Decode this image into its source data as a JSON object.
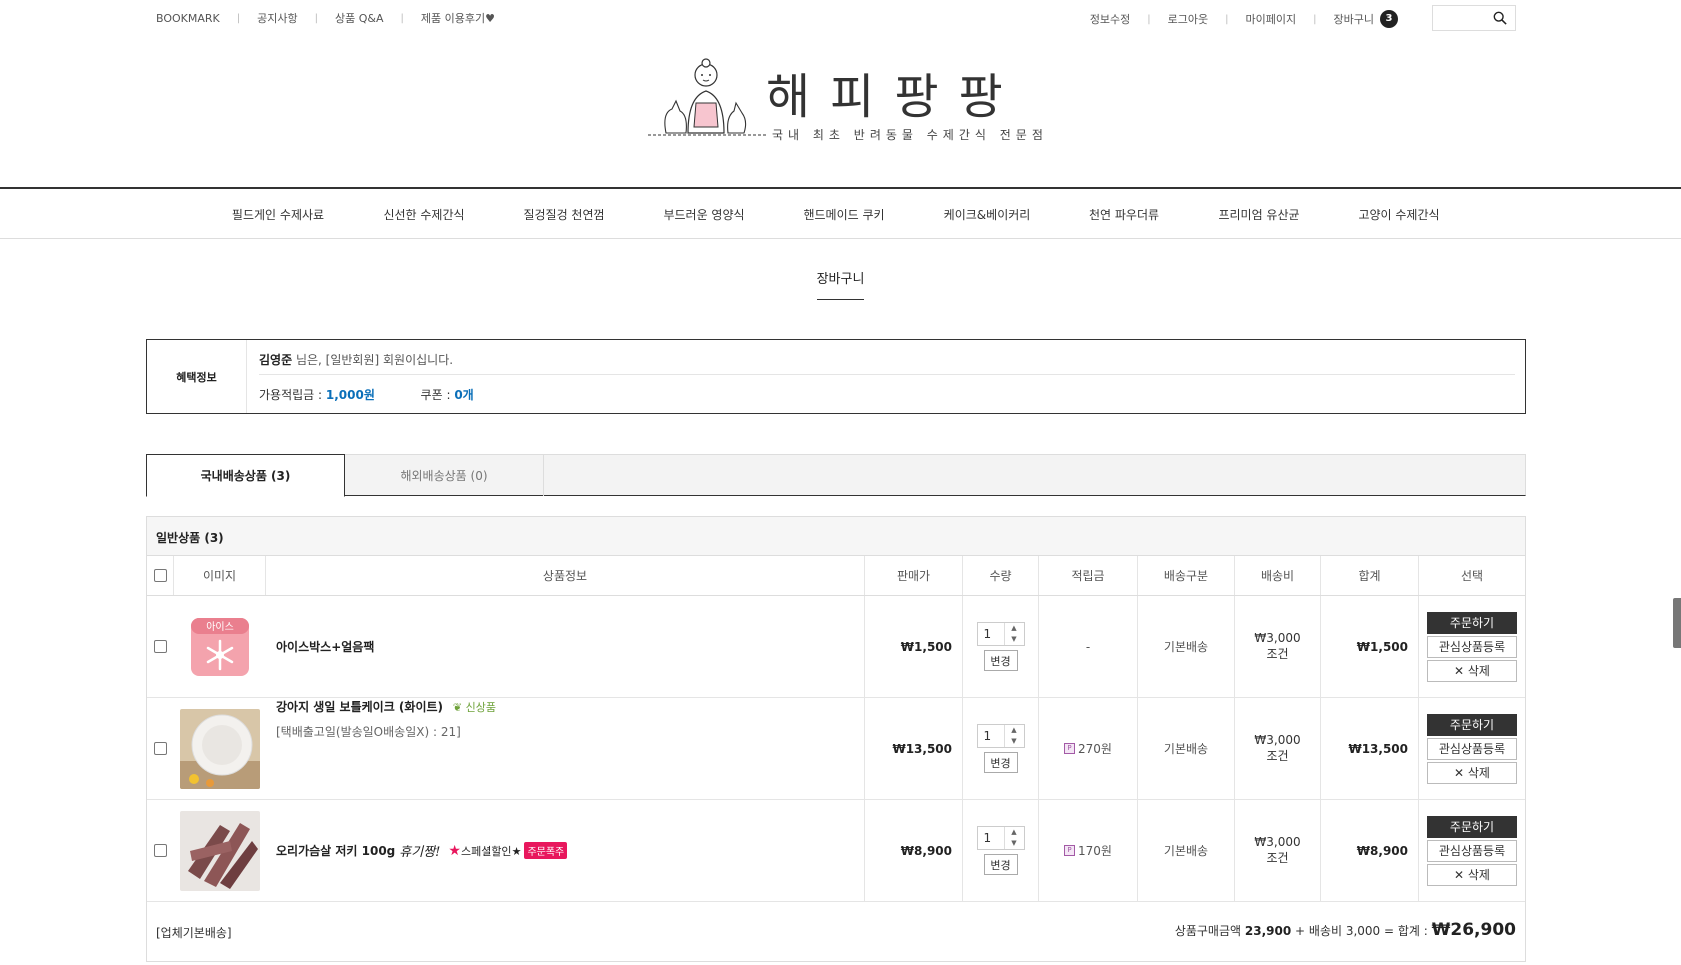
{
  "topbar": {
    "left": [
      "BOOKMARK",
      "공지사항",
      "상품 Q&A",
      "제품 이용후기♥"
    ],
    "right": [
      "정보수정",
      "로그아웃",
      "마이페이지",
      "장바구니"
    ],
    "cart_count": "3"
  },
  "logo": {
    "brand": "해피팡팡",
    "tagline": "국내 최초 반려동물 수제간식 전문점"
  },
  "nav": [
    "필드게인 수제사료",
    "신선한 수제간식",
    "질겅질겅 천연껌",
    "부드러운 영양식",
    "핸드메이드 쿠키",
    "케이크&베이커리",
    "천연 파우더류",
    "프리미엄 유산균",
    "고양이 수제간식"
  ],
  "page_title": "장바구니",
  "benefit": {
    "label": "혜택정보",
    "member_name": "김영준",
    "member_text": "님은, [일반회원] 회원이십니다.",
    "points_label": "가용적립금 :",
    "points_value": "1,000원",
    "coupon_label": "쿠폰 :",
    "coupon_value": "0개"
  },
  "tabs": {
    "domestic": "국내배송상품 (3)",
    "overseas": "해외배송상품 (0)"
  },
  "cart": {
    "section_title": "일반상품 (3)",
    "headers": {
      "image": "이미지",
      "info": "상품정보",
      "price": "판매가",
      "qty": "수량",
      "points": "적립금",
      "ship_type": "배송구분",
      "ship_fee": "배송비",
      "total": "합계",
      "select": "선택"
    },
    "items": [
      {
        "name": "아이스박스+얼음팩",
        "option": "",
        "price": "₩1,500",
        "qty": "1",
        "points": "-",
        "ship_type": "기본배송",
        "ship_fee": "₩3,000",
        "ship_cond": "조건",
        "total": "₩1,500",
        "ice_label": "아이스"
      },
      {
        "name": "강아지 생일 보틀케이크 (화이트)",
        "badge": "신상품",
        "option": "[택배출고일(발송일O배송일X) : 21]",
        "price": "₩13,500",
        "qty": "1",
        "points": "270원",
        "ship_type": "기본배송",
        "ship_fee": "₩3,000",
        "ship_cond": "조건",
        "total": "₩13,500"
      },
      {
        "name": "오리가슴살 저키 100g",
        "script_tag": "휴기짱!",
        "sale_badge": "스페셜할인",
        "hot_badge": "주문폭주",
        "option": "",
        "price": "₩8,900",
        "qty": "1",
        "points": "170원",
        "ship_type": "기본배송",
        "ship_fee": "₩3,000",
        "ship_cond": "조건",
        "total": "₩8,900"
      }
    ],
    "buttons": {
      "order": "주문하기",
      "wish": "관심상품등록",
      "delete": "✕ 삭제",
      "change": "변경"
    },
    "footer": {
      "left": "[업체기본배송]",
      "summary_label": "상품구매금액",
      "subtotal": "23,900",
      "plus_ship": "+ 배송비 3,000 = 합계 :",
      "grand_total": "₩26,900"
    }
  },
  "colors": {
    "accent_blue": "#0a6fb9",
    "dark": "#333333",
    "hot_pink": "#e8175d",
    "points_purple": "#a35aa6"
  }
}
